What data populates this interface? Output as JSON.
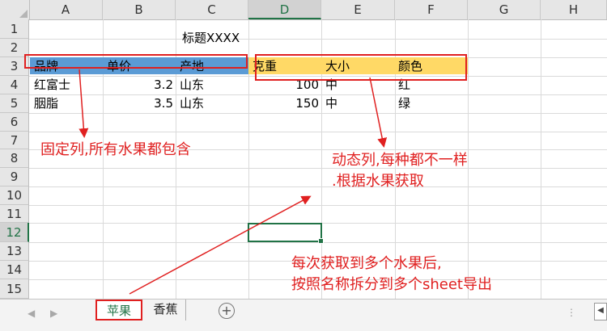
{
  "columns": [
    "A",
    "B",
    "C",
    "D",
    "E",
    "F",
    "G",
    "H"
  ],
  "rows": [
    "1",
    "2",
    "3",
    "4",
    "5",
    "6",
    "7",
    "8",
    "9",
    "10",
    "11",
    "12",
    "13",
    "14",
    "15"
  ],
  "selected": {
    "column": "D",
    "row": "12"
  },
  "title_cell": "标题XXXX",
  "header_row": [
    "品牌",
    "单价",
    "产地",
    "克重",
    "大小",
    "颜色"
  ],
  "data_rows": [
    [
      "红富士",
      "3.2",
      "山东",
      "100",
      "中",
      "红"
    ],
    [
      "胭脂",
      "3.5",
      "山东",
      "150",
      "中",
      "绿"
    ]
  ],
  "annotations": {
    "fixed_cols": "固定列,所有水果都包含",
    "dynamic_cols_line1": "动态列,每种都不一样",
    "dynamic_cols_line2": ".根据水果获取",
    "split_line1": "每次获取到多个水果后,",
    "split_line2": "按照名称拆分到多个sheet导出"
  },
  "sheet_tabs": [
    "苹果",
    "香蕉"
  ],
  "active_tab": "苹果",
  "add_sheet": "+",
  "icons": [
    "prev-sheet-icon",
    "next-sheet-icon",
    "add-sheet-icon",
    "scroll-left-icon"
  ],
  "colors": {
    "fixed_band": "#5b9bd5",
    "dynamic_band": "#ffd966",
    "annotation": "#e02020",
    "excel_green": "#217346"
  }
}
